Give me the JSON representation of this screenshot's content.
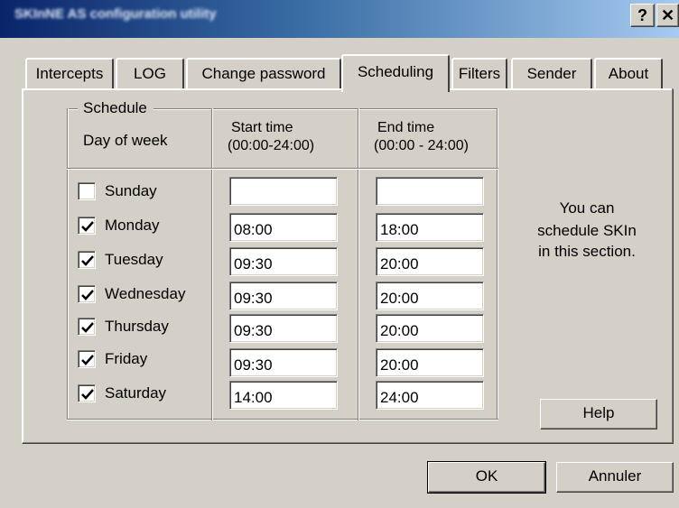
{
  "window": {
    "title": "SKInNE AS configuration utility",
    "help_glyph": "?",
    "close_glyph": "✕"
  },
  "tabs": [
    {
      "label": "Intercepts"
    },
    {
      "label": "LOG"
    },
    {
      "label": "Change password"
    },
    {
      "label": "Scheduling",
      "active": true
    },
    {
      "label": "Filters"
    },
    {
      "label": "Sender"
    },
    {
      "label": "About"
    }
  ],
  "schedule": {
    "group_label": "Schedule",
    "col_day": "Day of week",
    "col_start_line1": "Start time",
    "col_start_line2": "(00:00-24:00)",
    "col_end_line1": "End time",
    "col_end_line2": "(00:00 - 24:00)",
    "rows": [
      {
        "day": "Sunday",
        "checked": false,
        "start": "",
        "end": ""
      },
      {
        "day": "Monday",
        "checked": true,
        "start": "08:00",
        "end": "18:00"
      },
      {
        "day": "Tuesday",
        "checked": true,
        "start": "09:30",
        "end": "20:00"
      },
      {
        "day": "Wednesday",
        "checked": true,
        "start": "09:30",
        "end": "20:00"
      },
      {
        "day": "Thursday",
        "checked": true,
        "start": "09:30",
        "end": "20:00"
      },
      {
        "day": "Friday",
        "checked": true,
        "start": "09:30",
        "end": "20:00"
      },
      {
        "day": "Saturday",
        "checked": true,
        "start": "14:00",
        "end": "24:00"
      }
    ]
  },
  "info": {
    "line1": "You can",
    "line2": "schedule SKIn",
    "line3": "in this section."
  },
  "buttons": {
    "help": "Help",
    "ok": "OK",
    "cancel": "Annuler"
  }
}
